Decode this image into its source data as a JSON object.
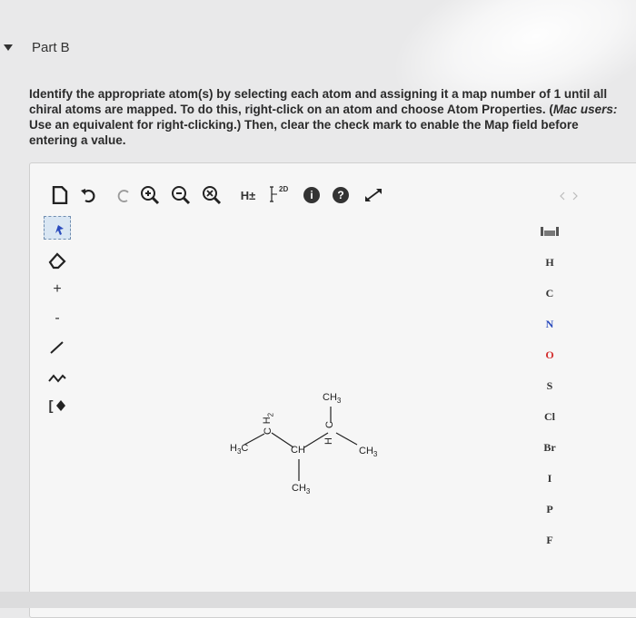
{
  "part": {
    "title": "Part B"
  },
  "instructions": {
    "text_before_mac": "Identify the appropriate atom(s) by selecting each atom and assigning it a map number of 1 until all chiral atoms are mapped. To do this, right-click on an atom and choose Atom Properties. (",
    "mac_users": "Mac users:",
    "text_after_mac": " Use an equivalent for right-clicking.) Then, clear the check mark to enable the Map field before entering a value."
  },
  "toolbar": {
    "hydrogen_label": "H±",
    "info_label": "i",
    "help_label": "?",
    "clean_2d_label": "2D"
  },
  "left_tools": {
    "plus_label": "+",
    "minus_label": "-",
    "bracket_label": "[",
    "chain_label": "Z"
  },
  "atoms": [
    "H",
    "C",
    "N",
    "O",
    "S",
    "Cl",
    "Br",
    "I",
    "P",
    "F"
  ],
  "molecule": {
    "ch3_top": "CH",
    "ch3_top_sub": "3",
    "h2_label": "H",
    "h2_sub": "2",
    "c_upper": "C",
    "h3c_left": "H",
    "h3c_left_sub": "3",
    "h3c_left_c": "C",
    "ch_mid": "CH",
    "h_mid": "H",
    "c_mid": "C",
    "ch3_right": "CH",
    "ch3_right_sub": "3",
    "ch3_bottom": "CH",
    "ch3_bottom_sub": "3"
  }
}
